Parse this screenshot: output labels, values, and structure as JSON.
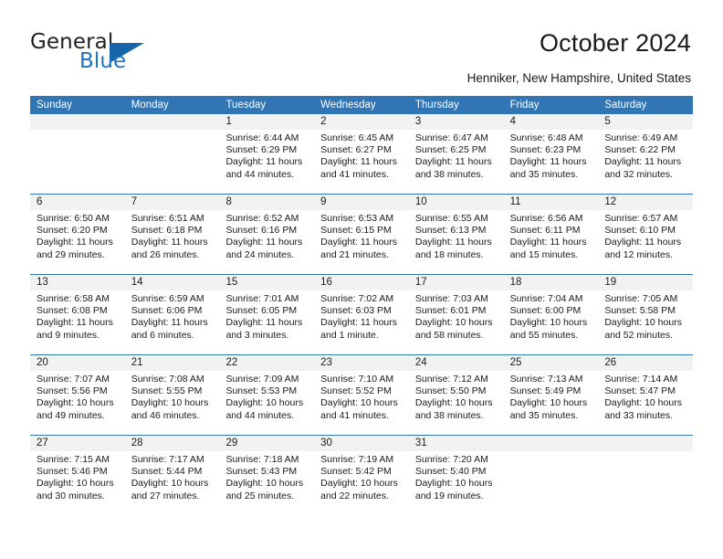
{
  "brand": {
    "name_part1": "General",
    "name_part2": "Blue",
    "mark": "triangle-logo"
  },
  "header": {
    "title": "October 2024",
    "location": "Henniker, New Hampshire, United States"
  },
  "colors": {
    "header_blue": "#3275b5",
    "brand_blue": "#1f72bd",
    "day_strip_gray": "#f2f2f2",
    "text": "#1a1a1a"
  },
  "calendar": {
    "weekday_headers": [
      "Sunday",
      "Monday",
      "Tuesday",
      "Wednesday",
      "Thursday",
      "Friday",
      "Saturday"
    ],
    "labels": {
      "sunrise": "Sunrise:",
      "sunset": "Sunset:",
      "daylight": "Daylight:"
    },
    "weeks": [
      [
        {
          "day": "",
          "empty": true
        },
        {
          "day": "",
          "empty": true
        },
        {
          "day": "1",
          "sunrise": "Sunrise: 6:44 AM",
          "sunset": "Sunset: 6:29 PM",
          "daylight": "Daylight: 11 hours and 44 minutes."
        },
        {
          "day": "2",
          "sunrise": "Sunrise: 6:45 AM",
          "sunset": "Sunset: 6:27 PM",
          "daylight": "Daylight: 11 hours and 41 minutes."
        },
        {
          "day": "3",
          "sunrise": "Sunrise: 6:47 AM",
          "sunset": "Sunset: 6:25 PM",
          "daylight": "Daylight: 11 hours and 38 minutes."
        },
        {
          "day": "4",
          "sunrise": "Sunrise: 6:48 AM",
          "sunset": "Sunset: 6:23 PM",
          "daylight": "Daylight: 11 hours and 35 minutes."
        },
        {
          "day": "5",
          "sunrise": "Sunrise: 6:49 AM",
          "sunset": "Sunset: 6:22 PM",
          "daylight": "Daylight: 11 hours and 32 minutes."
        }
      ],
      [
        {
          "day": "6",
          "sunrise": "Sunrise: 6:50 AM",
          "sunset": "Sunset: 6:20 PM",
          "daylight": "Daylight: 11 hours and 29 minutes."
        },
        {
          "day": "7",
          "sunrise": "Sunrise: 6:51 AM",
          "sunset": "Sunset: 6:18 PM",
          "daylight": "Daylight: 11 hours and 26 minutes."
        },
        {
          "day": "8",
          "sunrise": "Sunrise: 6:52 AM",
          "sunset": "Sunset: 6:16 PM",
          "daylight": "Daylight: 11 hours and 24 minutes."
        },
        {
          "day": "9",
          "sunrise": "Sunrise: 6:53 AM",
          "sunset": "Sunset: 6:15 PM",
          "daylight": "Daylight: 11 hours and 21 minutes."
        },
        {
          "day": "10",
          "sunrise": "Sunrise: 6:55 AM",
          "sunset": "Sunset: 6:13 PM",
          "daylight": "Daylight: 11 hours and 18 minutes."
        },
        {
          "day": "11",
          "sunrise": "Sunrise: 6:56 AM",
          "sunset": "Sunset: 6:11 PM",
          "daylight": "Daylight: 11 hours and 15 minutes."
        },
        {
          "day": "12",
          "sunrise": "Sunrise: 6:57 AM",
          "sunset": "Sunset: 6:10 PM",
          "daylight": "Daylight: 11 hours and 12 minutes."
        }
      ],
      [
        {
          "day": "13",
          "sunrise": "Sunrise: 6:58 AM",
          "sunset": "Sunset: 6:08 PM",
          "daylight": "Daylight: 11 hours and 9 minutes."
        },
        {
          "day": "14",
          "sunrise": "Sunrise: 6:59 AM",
          "sunset": "Sunset: 6:06 PM",
          "daylight": "Daylight: 11 hours and 6 minutes."
        },
        {
          "day": "15",
          "sunrise": "Sunrise: 7:01 AM",
          "sunset": "Sunset: 6:05 PM",
          "daylight": "Daylight: 11 hours and 3 minutes."
        },
        {
          "day": "16",
          "sunrise": "Sunrise: 7:02 AM",
          "sunset": "Sunset: 6:03 PM",
          "daylight": "Daylight: 11 hours and 1 minute."
        },
        {
          "day": "17",
          "sunrise": "Sunrise: 7:03 AM",
          "sunset": "Sunset: 6:01 PM",
          "daylight": "Daylight: 10 hours and 58 minutes."
        },
        {
          "day": "18",
          "sunrise": "Sunrise: 7:04 AM",
          "sunset": "Sunset: 6:00 PM",
          "daylight": "Daylight: 10 hours and 55 minutes."
        },
        {
          "day": "19",
          "sunrise": "Sunrise: 7:05 AM",
          "sunset": "Sunset: 5:58 PM",
          "daylight": "Daylight: 10 hours and 52 minutes."
        }
      ],
      [
        {
          "day": "20",
          "sunrise": "Sunrise: 7:07 AM",
          "sunset": "Sunset: 5:56 PM",
          "daylight": "Daylight: 10 hours and 49 minutes."
        },
        {
          "day": "21",
          "sunrise": "Sunrise: 7:08 AM",
          "sunset": "Sunset: 5:55 PM",
          "daylight": "Daylight: 10 hours and 46 minutes."
        },
        {
          "day": "22",
          "sunrise": "Sunrise: 7:09 AM",
          "sunset": "Sunset: 5:53 PM",
          "daylight": "Daylight: 10 hours and 44 minutes."
        },
        {
          "day": "23",
          "sunrise": "Sunrise: 7:10 AM",
          "sunset": "Sunset: 5:52 PM",
          "daylight": "Daylight: 10 hours and 41 minutes."
        },
        {
          "day": "24",
          "sunrise": "Sunrise: 7:12 AM",
          "sunset": "Sunset: 5:50 PM",
          "daylight": "Daylight: 10 hours and 38 minutes."
        },
        {
          "day": "25",
          "sunrise": "Sunrise: 7:13 AM",
          "sunset": "Sunset: 5:49 PM",
          "daylight": "Daylight: 10 hours and 35 minutes."
        },
        {
          "day": "26",
          "sunrise": "Sunrise: 7:14 AM",
          "sunset": "Sunset: 5:47 PM",
          "daylight": "Daylight: 10 hours and 33 minutes."
        }
      ],
      [
        {
          "day": "27",
          "sunrise": "Sunrise: 7:15 AM",
          "sunset": "Sunset: 5:46 PM",
          "daylight": "Daylight: 10 hours and 30 minutes."
        },
        {
          "day": "28",
          "sunrise": "Sunrise: 7:17 AM",
          "sunset": "Sunset: 5:44 PM",
          "daylight": "Daylight: 10 hours and 27 minutes."
        },
        {
          "day": "29",
          "sunrise": "Sunrise: 7:18 AM",
          "sunset": "Sunset: 5:43 PM",
          "daylight": "Daylight: 10 hours and 25 minutes."
        },
        {
          "day": "30",
          "sunrise": "Sunrise: 7:19 AM",
          "sunset": "Sunset: 5:42 PM",
          "daylight": "Daylight: 10 hours and 22 minutes."
        },
        {
          "day": "31",
          "sunrise": "Sunrise: 7:20 AM",
          "sunset": "Sunset: 5:40 PM",
          "daylight": "Daylight: 10 hours and 19 minutes."
        },
        {
          "day": "",
          "empty": true
        },
        {
          "day": "",
          "empty": true
        }
      ]
    ]
  }
}
